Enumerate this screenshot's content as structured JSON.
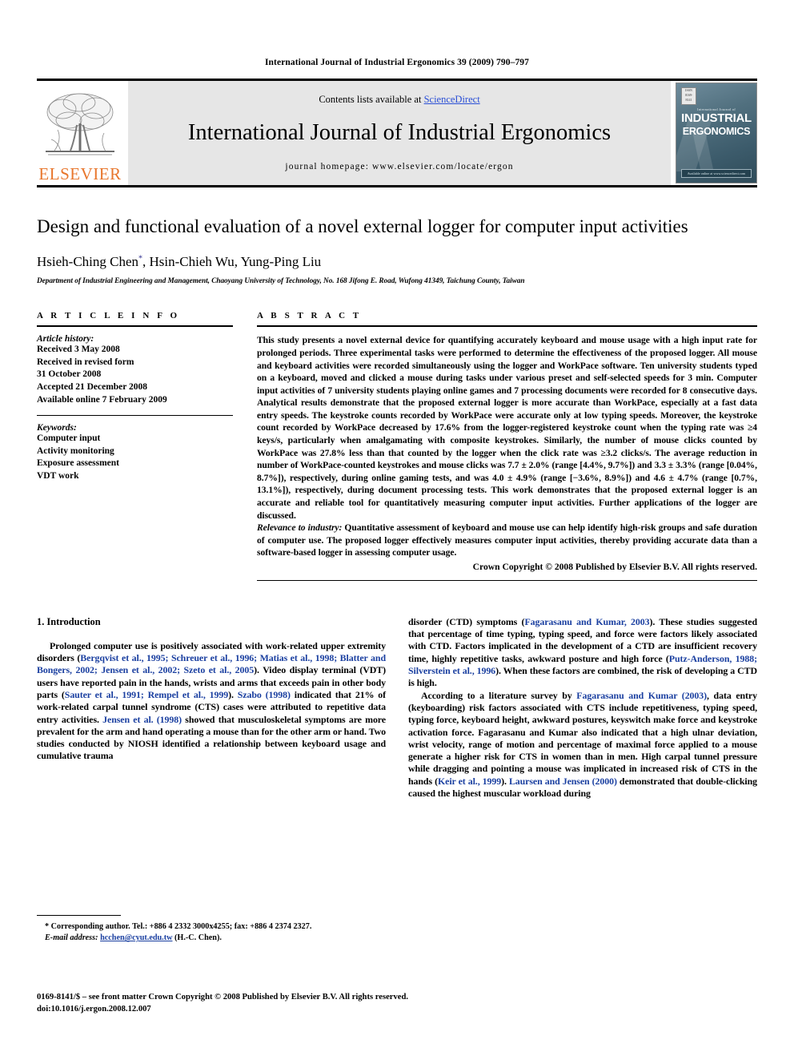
{
  "running_head": "International Journal of Industrial Ergonomics 39 (2009) 790–797",
  "masthead": {
    "publisher_name": "ELSEVIER",
    "contents_prefix": "Contents lists available at ",
    "sciencedirect": "ScienceDirect",
    "journal_title": "International Journal of Industrial Ergonomics",
    "homepage": "journal homepage: www.elsevier.com/locate/ergon",
    "cover": {
      "superline": "International Journal of",
      "line1": "INDUSTRIAL",
      "line2": "ERGONOMICS",
      "corner_box": "ISSN 0169-8141",
      "bottom_band": "Available online at www.sciencedirect.com"
    },
    "link_color": "#2a4fd6",
    "elsevier_orange": "#E8762C"
  },
  "article": {
    "title": "Design and functional evaluation of a novel external logger for computer input activities",
    "authors": "Hsieh-Ching Chen",
    "authors_rest": ", Hsin-Chieh Wu, Yung-Ping Liu",
    "corresponding_marker": "*",
    "affiliation": "Department of Industrial Engineering and Management, Chaoyang University of Technology, No. 168 Jifong E. Road, Wufong 41349, Taichung County, Taiwan"
  },
  "article_info": {
    "heading": "A R T I C L E   I N F O",
    "history_label": "Article history:",
    "history": [
      "Received 3 May 2008",
      "Received in revised form",
      "31 October 2008",
      "Accepted 21 December 2008",
      "Available online 7 February 2009"
    ],
    "keywords_label": "Keywords:",
    "keywords": [
      "Computer input",
      "Activity monitoring",
      "Exposure assessment",
      "VDT work"
    ]
  },
  "abstract": {
    "heading": "A B S T R A C T",
    "body": "This study presents a novel external device for quantifying accurately keyboard and mouse usage with a high input rate for prolonged periods. Three experimental tasks were performed to determine the effectiveness of the proposed logger. All mouse and keyboard activities were recorded simultaneously using the logger and WorkPace software. Ten university students typed on a keyboard, moved and clicked a mouse during tasks under various preset and self-selected speeds for 3 min. Computer input activities of 7 university students playing online games and 7 processing documents were recorded for 8 consecutive days. Analytical results demonstrate that the proposed external logger is more accurate than WorkPace, especially at a fast data entry speeds. The keystroke counts recorded by WorkPace were accurate only at low typing speeds. Moreover, the keystroke count recorded by WorkPace decreased by 17.6% from the logger-registered keystroke count when the typing rate was ≥4 keys/s, particularly when amalgamating with composite keystrokes. Similarly, the number of mouse clicks counted by WorkPace was 27.8% less than that counted by the logger when the click rate was ≥3.2 clicks/s. The average reduction in number of WorkPace-counted keystrokes and mouse clicks was 7.7 ± 2.0% (range [4.4%, 9.7%]) and 3.3 ± 3.3% (range [0.04%, 8.7%]), respectively, during online gaming tests, and was 4.0 ± 4.9% (range [−3.6%, 8.9%]) and 4.6 ± 4.7% (range [0.7%, 13.1%]), respectively, during document processing tests. This work demonstrates that the proposed external logger is an accurate and reliable tool for quantitatively measuring computer input activities. Further applications of the logger are discussed.",
    "relevance_label": "Relevance to industry:",
    "relevance_body": " Quantitative assessment of keyboard and mouse use can help identify high-risk groups and safe duration of computer use. The proposed logger effectively measures computer input activities, thereby providing accurate data than a software-based logger in assessing computer usage.",
    "copyright": "Crown Copyright © 2008 Published by Elsevier B.V. All rights reserved."
  },
  "introduction": {
    "section_title": "1. Introduction",
    "left_p1_a": "Prolonged computer use is positively associated with work-related upper extremity disorders (",
    "left_p1_cite1": "Bergqvist et al., 1995; Schreuer et al., 1996; Matias et al., 1998; Blatter and Bongers, 2002; Jensen et al., 2002; Szeto et al., 2005",
    "left_p1_b": "). Video display terminal (VDT) users have reported pain in the hands, wrists and arms that exceeds pain in other body parts (",
    "left_p1_cite2": "Sauter et al., 1991; Rempel et al., 1999",
    "left_p1_c": "). ",
    "left_p1_cite3": "Szabo (1998)",
    "left_p1_d": " indicated that 21% of work-related carpal tunnel syndrome (CTS) cases were attributed to repetitive data entry activities. ",
    "left_p1_cite4": "Jensen et al. (1998)",
    "left_p1_e": " showed that musculoskeletal symptoms are more prevalent for the arm and hand operating a mouse than for the other arm or hand. Two studies conducted by NIOSH identified a relationship between keyboard usage and cumulative trauma",
    "right_p1_a": "disorder (CTD) symptoms (",
    "right_p1_cite1": "Fagarasanu and Kumar, 2003",
    "right_p1_b": "). These studies suggested that percentage of time typing, typing speed, and force were factors likely associated with CTD. Factors implicated in the development of a CTD are insufficient recovery time, highly repetitive tasks, awkward posture and high force (",
    "right_p1_cite2": "Putz-Anderson, 1988; Silverstein et al., 1996",
    "right_p1_c": "). When these factors are combined, the risk of developing a CTD is high.",
    "right_p2_a": "According to a literature survey by ",
    "right_p2_cite1": "Fagarasanu and Kumar (2003)",
    "right_p2_b": ", data entry (keyboarding) risk factors associated with CTS include repetitiveness, typing speed, typing force, keyboard height, awkward postures, keyswitch make force and keystroke activation force. Fagarasanu and Kumar also indicated that a high ulnar deviation, wrist velocity, range of motion and percentage of maximal force applied to a mouse generate a higher risk for CTS in women than in men. High carpal tunnel pressure while dragging and pointing a mouse was implicated in increased risk of CTS in the hands (",
    "right_p2_cite2": "Keir et al., 1999",
    "right_p2_c": "). ",
    "right_p2_cite3": "Laursen and Jensen (2000)",
    "right_p2_d": " demonstrated that double-clicking caused the highest muscular workload during",
    "cite_color": "#1a3fa0"
  },
  "footnote": {
    "corresponding": "* Corresponding author. Tel.: +886 4 2332 3000x4255; fax: +886 4 2374 2327.",
    "email_label": "E-mail address:",
    "email": "hcchen@cyut.edu.tw",
    "email_suffix": " (H.-C. Chen)."
  },
  "footer": {
    "issn_line": "0169-8141/$ – see front matter Crown Copyright © 2008 Published by Elsevier B.V. All rights reserved.",
    "doi_line": "doi:10.1016/j.ergon.2008.12.007"
  }
}
